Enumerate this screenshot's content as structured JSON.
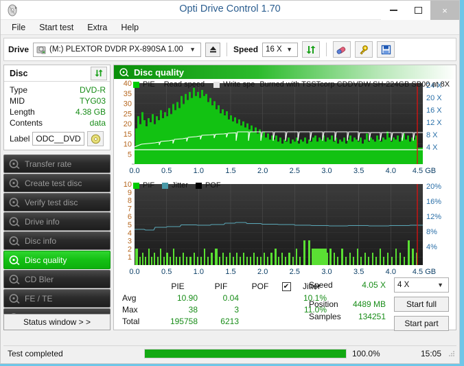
{
  "window": {
    "title": "Opti Drive Control 1.70",
    "icon": "disc-icon",
    "buttons": {
      "minimize": "–",
      "maximize": "□",
      "close": "×"
    }
  },
  "menu": {
    "items": [
      "File",
      "Start test",
      "Extra",
      "Help"
    ]
  },
  "toolbar": {
    "drive_label": "Drive",
    "drive_value": "(M:)   PLEXTOR DVDR   PX-890SA 1.00",
    "eject_icon": "eject-icon",
    "speed_label": "Speed",
    "speed_value": "16 X",
    "refresh_icon": "refresh-icon",
    "eraser_icon": "eraser-icon",
    "key_icon": "key-icon",
    "save_icon": "save-icon"
  },
  "disc": {
    "header": "Disc",
    "refresh_icon": "refresh-icon",
    "rows": [
      {
        "key": "Type",
        "value": "DVD-R"
      },
      {
        "key": "MID",
        "value": "TYG03"
      },
      {
        "key": "Length",
        "value": "4.38 GB"
      },
      {
        "key": "Contents",
        "value": "data"
      }
    ],
    "label_key": "Label",
    "label_value": "ODC__DVD",
    "label_button_icon": "disc-icon"
  },
  "sidebar": {
    "items": [
      {
        "label": "Transfer rate",
        "icon": "disc-icon",
        "active": false
      },
      {
        "label": "Create test disc",
        "icon": "disc-icon",
        "active": false
      },
      {
        "label": "Verify test disc",
        "icon": "disc-icon",
        "active": false
      },
      {
        "label": "Drive info",
        "icon": "disc-icon",
        "active": false
      },
      {
        "label": "Disc info",
        "icon": "disc-icon",
        "active": false
      },
      {
        "label": "Disc quality",
        "icon": "disc-icon",
        "active": true
      },
      {
        "label": "CD Bler",
        "icon": "disc-icon",
        "active": false
      },
      {
        "label": "FE / TE",
        "icon": "disc-icon",
        "active": false
      },
      {
        "label": "Extra tests",
        "icon": "disc-icon",
        "active": false
      }
    ],
    "status_window_button": "Status window > >"
  },
  "main": {
    "header": "Disc quality",
    "header_icon": "disc-icon",
    "burn_info": "Burned with TSSTcorp CDDVDW SH-224GB SB00 at 8X"
  },
  "stats": {
    "columns": [
      "PIE",
      "PIF",
      "POF",
      "Jitter"
    ],
    "jitter_checked": true,
    "jitter_check_glyph": "✔",
    "rows": [
      {
        "label": "Avg",
        "pie": "10.90",
        "pif": "0.04",
        "pof": "",
        "jitter": "10.1%"
      },
      {
        "label": "Max",
        "pie": "38",
        "pif": "3",
        "pof": "",
        "jitter": "11.0%"
      },
      {
        "label": "Total",
        "pie": "195758",
        "pif": "6213",
        "pof": "",
        "jitter": ""
      }
    ]
  },
  "readout": {
    "speed_key": "Speed",
    "speed_value": "4.05 X",
    "position_key": "Position",
    "position_value": "4489 MB",
    "samples_key": "Samples",
    "samples_value": "134251",
    "speed_select": "4 X",
    "start_full": "Start full",
    "start_part": "Start part"
  },
  "statusbar": {
    "text": "Test completed",
    "progress_percent": 100.0,
    "progress_label": "100.0%",
    "time": "15:05"
  },
  "chart_data": [
    {
      "type": "area",
      "name": "pie-chart",
      "title": "PIE",
      "xlabel": "GB",
      "ylabel": "PIE",
      "xlim": [
        0.0,
        4.5
      ],
      "ylim": [
        0,
        40
      ],
      "xticks": [
        "0.0",
        "0.5",
        "1.0",
        "1.5",
        "2.0",
        "2.5",
        "3.0",
        "3.5",
        "4.0",
        "4.5 GB"
      ],
      "yticks": [
        "40",
        "35",
        "30",
        "25",
        "20",
        "15",
        "10",
        "5"
      ],
      "y2ticks": [
        "24 X",
        "20 X",
        "16 X",
        "12 X",
        "8 X",
        "4 X"
      ],
      "y2lim": [
        0,
        26
      ],
      "legend": [
        {
          "label": "PIE",
          "color": "#00cc00"
        },
        {
          "label": "Read speed",
          "color": "#ffffff"
        },
        {
          "label": "Write spe",
          "color": "#d8d8d8"
        }
      ],
      "legend_position": "top-left",
      "grid": true,
      "series": [
        {
          "name": "PIE",
          "color": "#00cc00",
          "x": [
            0.0,
            0.05,
            0.09,
            0.14,
            0.18,
            0.23,
            0.27,
            0.32,
            0.36,
            0.41,
            0.45,
            0.5,
            0.55,
            0.59,
            0.64,
            0.68,
            0.73,
            0.77,
            0.82,
            0.86,
            0.91,
            0.95,
            1.0,
            1.05,
            1.09,
            1.14,
            1.18,
            1.23,
            1.27,
            1.32,
            1.36,
            1.41,
            1.45,
            1.5,
            1.55,
            1.59,
            1.64,
            1.68,
            1.73,
            1.77,
            1.82,
            1.86,
            1.91,
            1.95,
            2.0,
            2.05,
            2.09,
            2.14,
            2.18,
            2.23,
            2.27,
            2.32,
            2.36,
            2.41,
            2.45,
            2.5,
            2.55,
            2.59,
            2.64,
            2.68,
            2.73,
            2.77,
            2.82,
            2.86,
            2.91,
            2.95,
            3.0,
            3.05,
            3.09,
            3.14,
            3.18,
            3.23,
            3.27,
            3.32,
            3.36,
            3.41,
            3.45,
            3.5,
            3.55,
            3.59,
            3.64,
            3.68,
            3.73,
            3.77,
            3.82,
            3.86,
            3.91,
            3.95,
            4.0,
            4.05,
            4.09,
            4.14,
            4.18,
            4.23,
            4.27,
            4.32,
            4.36,
            4.41,
            4.45,
            4.5
          ],
          "values": [
            18,
            24,
            20,
            26,
            22,
            19,
            23,
            21,
            25,
            20,
            24,
            22,
            27,
            23,
            26,
            24,
            28,
            25,
            30,
            27,
            31,
            28,
            33,
            30,
            35,
            32,
            36,
            33,
            38,
            34,
            36,
            33,
            37,
            34,
            35,
            31,
            33,
            29,
            31,
            27,
            29,
            25,
            27,
            24,
            26,
            22,
            24,
            21,
            23,
            20,
            22,
            19,
            21,
            18,
            20,
            17,
            19,
            16,
            18,
            15,
            17,
            14,
            16,
            13,
            15,
            12,
            14,
            13,
            15,
            12,
            14,
            11,
            13,
            12,
            14,
            11,
            13,
            12,
            14,
            11,
            13,
            12,
            14,
            11,
            13,
            12,
            14,
            13,
            15,
            12,
            14,
            13,
            15,
            12,
            14,
            13,
            15,
            12,
            14,
            13
          ]
        },
        {
          "name": "Read speed",
          "color": "#ffffff",
          "x": [
            0.0,
            0.25,
            0.5,
            0.75,
            1.0,
            1.25,
            1.5,
            1.75,
            2.0,
            2.25,
            2.5,
            2.75,
            3.0,
            3.25,
            3.5,
            3.75,
            4.0,
            4.25,
            4.5
          ],
          "values_x_speed": [
            5.6,
            6.2,
            6.8,
            7.4,
            7.9,
            8.4,
            8.9,
            9.3,
            9.6,
            9.9,
            10.1,
            10.3,
            10.5,
            10.7,
            10.8,
            10.9,
            11.0,
            11.1,
            11.2
          ]
        }
      ]
    },
    {
      "type": "area",
      "name": "pif-chart",
      "title": "PIF",
      "xlabel": "GB",
      "ylabel": "PIF",
      "xlim": [
        0.0,
        4.5
      ],
      "ylim": [
        0,
        10
      ],
      "xticks": [
        "0.0",
        "0.5",
        "1.0",
        "1.5",
        "2.0",
        "2.5",
        "3.0",
        "3.5",
        "4.0",
        "4.5 GB"
      ],
      "yticks": [
        "10",
        "9",
        "8",
        "7",
        "6",
        "5",
        "4",
        "3",
        "2",
        "1"
      ],
      "y2ticks": [
        "20%",
        "16%",
        "12%",
        "8%",
        "4%"
      ],
      "y2lim": [
        0,
        22
      ],
      "legend": [
        {
          "label": "PIF",
          "color": "#00cc00"
        },
        {
          "label": "Jitter",
          "color": "#4a9aa8"
        },
        {
          "label": "POF",
          "color": "#000000"
        }
      ],
      "legend_position": "top-left",
      "grid": true,
      "series": [
        {
          "name": "PIF",
          "color": "#55e033",
          "x": [
            0.0,
            0.09,
            0.18,
            0.27,
            0.36,
            0.45,
            0.55,
            0.64,
            0.73,
            0.82,
            0.91,
            1.0,
            1.09,
            1.18,
            1.27,
            1.36,
            1.45,
            1.55,
            1.64,
            1.73,
            1.82,
            1.91,
            2.0,
            2.09,
            2.18,
            2.27,
            2.36,
            2.45,
            2.55,
            2.64,
            2.73,
            2.82,
            2.91,
            3.0,
            3.09,
            3.18,
            3.27,
            3.36,
            3.45,
            3.55,
            3.64,
            3.73,
            3.82,
            3.91,
            4.0,
            4.09,
            4.18,
            4.27,
            4.36,
            4.45
          ],
          "values": [
            2,
            1,
            2,
            1,
            2,
            1,
            1,
            2,
            1,
            1,
            2,
            1,
            2,
            1,
            2,
            1,
            1,
            2,
            1,
            1,
            2,
            1,
            2,
            1,
            2,
            1,
            1,
            2,
            1,
            3,
            3,
            2,
            2,
            2,
            2,
            1,
            1,
            2,
            1,
            1,
            2,
            1,
            1,
            2,
            1,
            3,
            1,
            1,
            2,
            1
          ]
        },
        {
          "name": "Jitter",
          "color": "#4a9aa8",
          "x": [
            0.0,
            0.25,
            0.5,
            0.75,
            1.0,
            1.25,
            1.5,
            1.75,
            2.0,
            2.25,
            2.5,
            2.75,
            3.0,
            3.25,
            3.5,
            3.75,
            4.0,
            4.25,
            4.5
          ],
          "values_percent": [
            9.4,
            9.3,
            9.8,
            10.0,
            10.1,
            10.2,
            10.3,
            10.5,
            10.6,
            10.4,
            10.3,
            10.3,
            10.2,
            10.1,
            10.1,
            10.0,
            10.0,
            10.0,
            10.1
          ]
        }
      ]
    }
  ]
}
